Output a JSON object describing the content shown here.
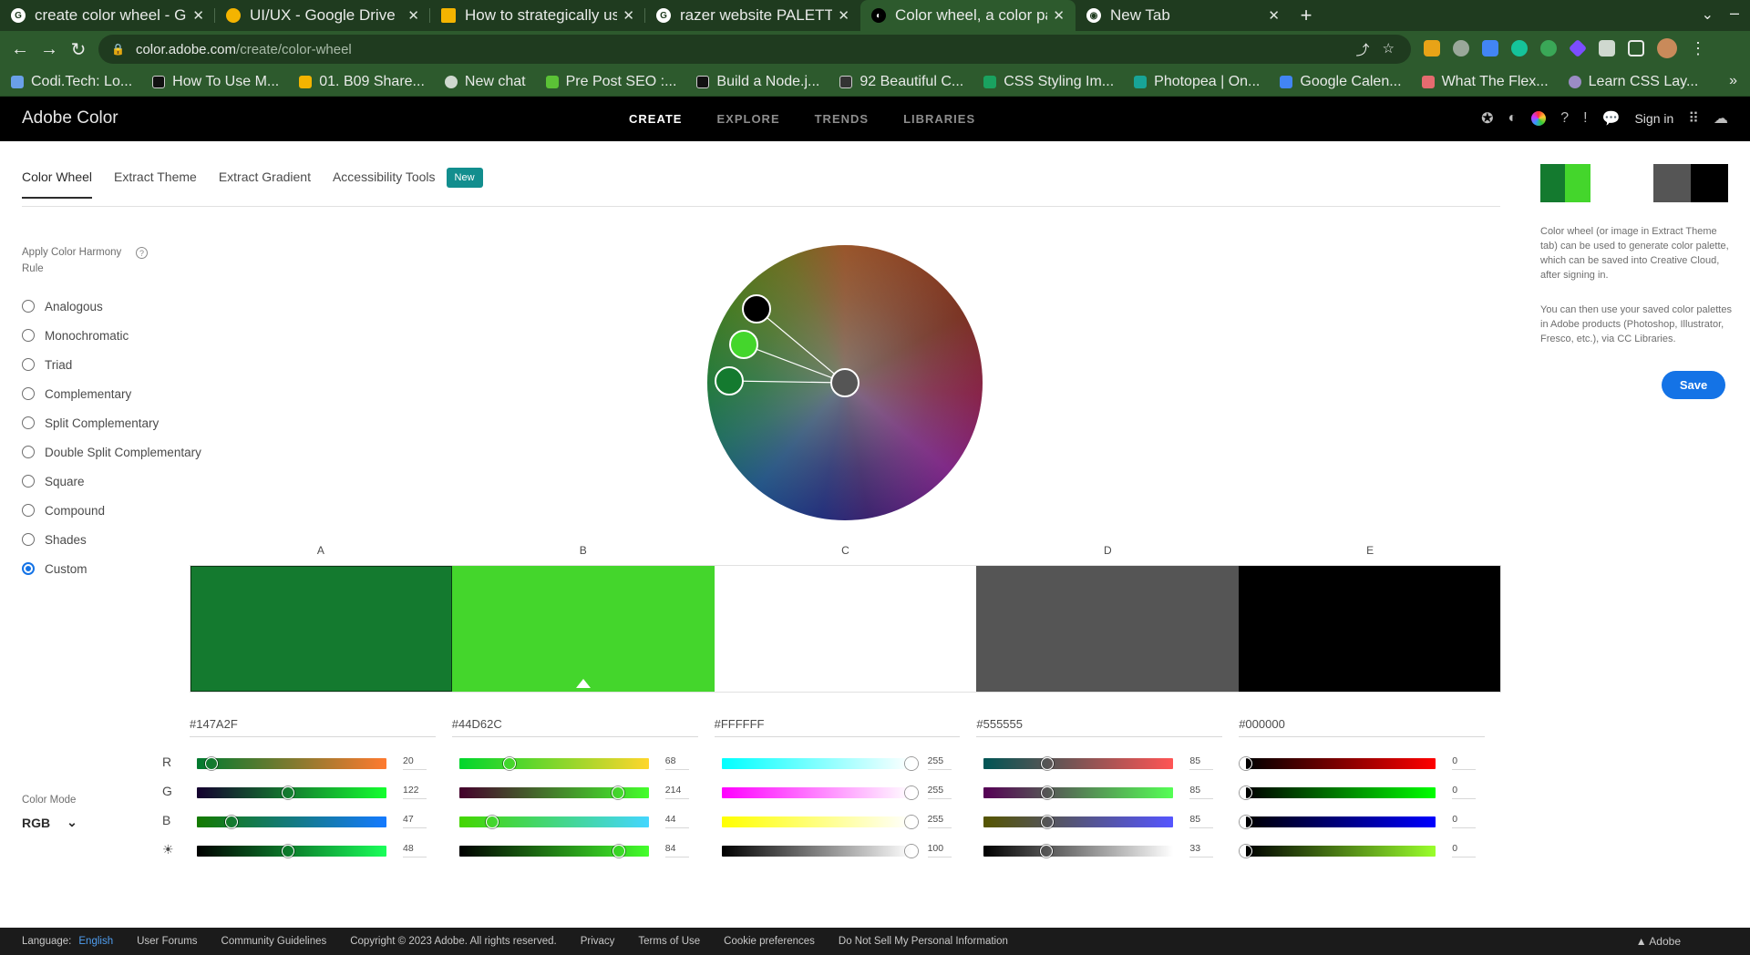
{
  "browser": {
    "tabs": [
      {
        "title": "create color wheel - Goog",
        "icon": "google-icon"
      },
      {
        "title": "UI/UX - Google Drive",
        "icon": "drive-icon"
      },
      {
        "title": "How to strategically use c",
        "icon": "slides-icon"
      },
      {
        "title": "razer website PALETTE - G",
        "icon": "google-icon"
      },
      {
        "title": "Color wheel, a color palet",
        "icon": "adobe-color-icon",
        "active": true
      },
      {
        "title": "New Tab",
        "icon": "chrome-icon"
      }
    ],
    "url_domain": "color.adobe.com",
    "url_path": "/create/color-wheel",
    "bookmarks": [
      "Codi.Tech: Lo...",
      "How To Use M...",
      "01. B09 Share...",
      "New chat",
      "Pre Post SEO :...",
      "Build a Node.j...",
      "92 Beautiful C...",
      "CSS Styling Im...",
      "Photopea | On...",
      "Google Calen...",
      "What The Flex...",
      "Learn CSS Lay..."
    ]
  },
  "app": {
    "brand": "Adobe Color",
    "nav": [
      "CREATE",
      "EXPLORE",
      "TRENDS",
      "LIBRARIES"
    ],
    "signin": "Sign in"
  },
  "subtabs": {
    "items": [
      "Color Wheel",
      "Extract Theme",
      "Extract Gradient",
      "Accessibility Tools"
    ],
    "new_badge": "New"
  },
  "harmony": {
    "title": "Apply Color Harmony Rule",
    "rules": [
      "Analogous",
      "Monochromatic",
      "Triad",
      "Complementary",
      "Split Complementary",
      "Double Split Complementary",
      "Square",
      "Compound",
      "Shades",
      "Custom"
    ],
    "selected": "Custom"
  },
  "swatches": [
    {
      "letter": "A",
      "hex": "#147A2F",
      "color": "#147A2F",
      "values": [
        "20",
        "122",
        "47",
        "48"
      ]
    },
    {
      "letter": "B",
      "hex": "#44D62C",
      "color": "#44D62C",
      "values": [
        "68",
        "214",
        "44",
        "84"
      ]
    },
    {
      "letter": "C",
      "hex": "#FFFFFF",
      "color": "#FFFFFF",
      "values": [
        "255",
        "255",
        "255",
        "100"
      ]
    },
    {
      "letter": "D",
      "hex": "#555555",
      "color": "#555555",
      "values": [
        "85",
        "85",
        "85",
        "33"
      ]
    },
    {
      "letter": "E",
      "hex": "#000000",
      "color": "#000000",
      "values": [
        "0",
        "0",
        "0",
        "0"
      ]
    }
  ],
  "channel_labels": [
    "R",
    "G",
    "B"
  ],
  "color_mode": {
    "label": "Color Mode",
    "value": "RGB"
  },
  "right_panel": {
    "text1": "Color wheel (or image in Extract Theme tab) can be used to generate color palette, which can be saved into Creative Cloud, after signing in.",
    "text2": "You can then use your saved color palettes in Adobe products (Photoshop, Illustrator, Fresco, etc.), via CC Libraries.",
    "save": "Save"
  },
  "footer": {
    "language_label": "Language:",
    "language": "English",
    "links": [
      "User Forums",
      "Community Guidelines",
      "Copyright © 2023 Adobe. All rights reserved.",
      "Privacy",
      "Terms of Use",
      "Cookie preferences",
      "Do Not Sell My Personal Information"
    ],
    "adobe": "Adobe"
  }
}
